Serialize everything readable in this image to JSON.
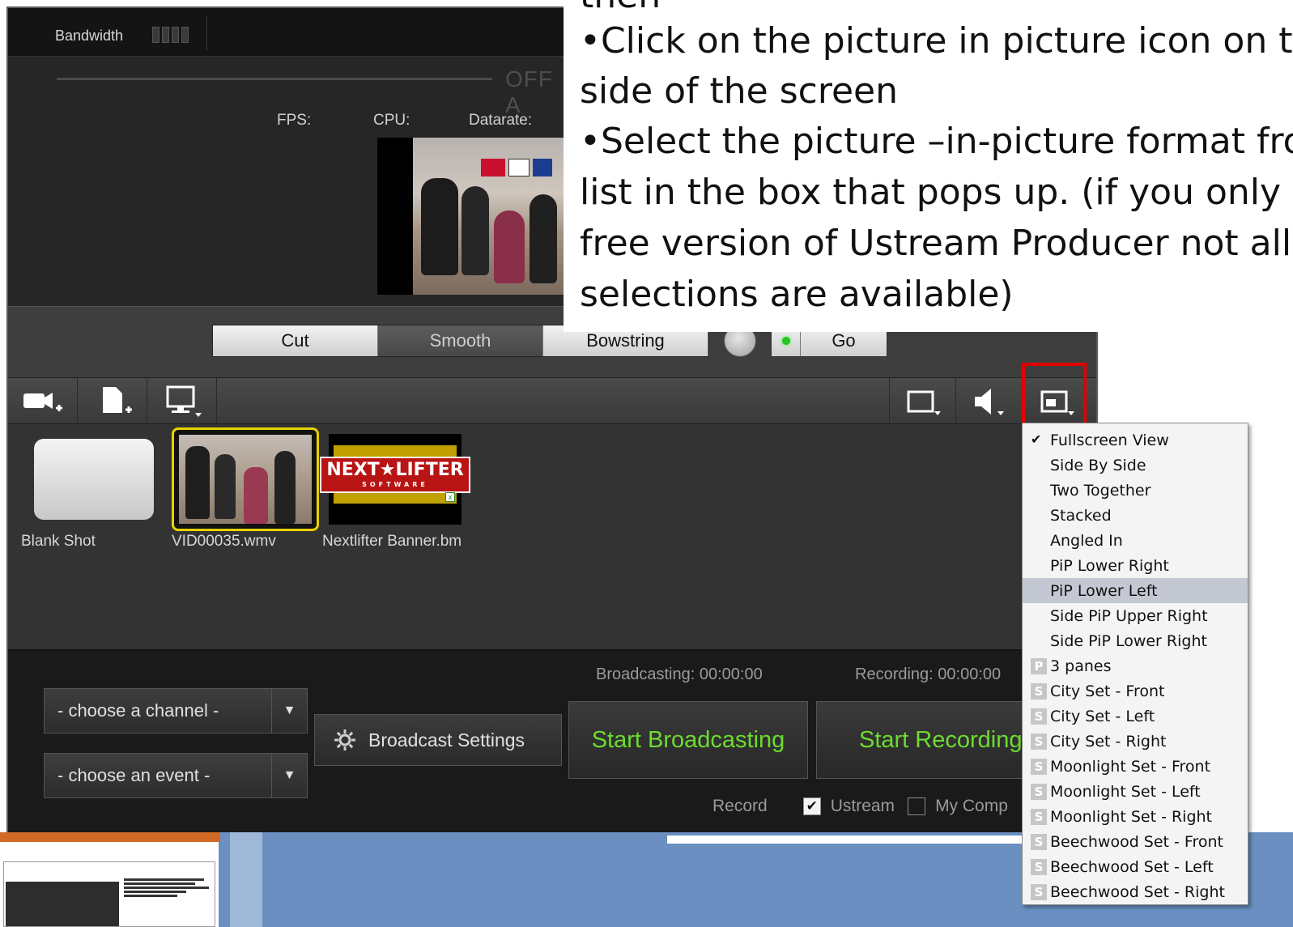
{
  "header": {
    "bandwidth_label": "Bandwidth",
    "off_label": "OFF A",
    "stats": {
      "fps": "FPS:",
      "cpu": "CPU:",
      "datarate": "Datarate:"
    }
  },
  "transitions": {
    "items": [
      "Cut",
      "Smooth",
      "Bowstring"
    ],
    "active": "Smooth",
    "go_label": "Go"
  },
  "toolbar": {
    "left": [
      "add-camera",
      "add-file",
      "add-screen"
    ],
    "right": [
      "layout",
      "audio",
      "picture-in-picture"
    ]
  },
  "media": {
    "items": [
      {
        "label": "Blank Shot"
      },
      {
        "label": "VID00035.wmv"
      },
      {
        "label": "Nextlifter Banner.bm"
      }
    ],
    "banner_logo": "NEXT★LIFTER",
    "banner_sub": "SOFTWARE"
  },
  "broadcast": {
    "broadcasting_time": "Broadcasting: 00:00:00",
    "recording_time": "Recording: 00:00:00",
    "channel_select": "- choose a channel -",
    "event_select": "- choose an event -",
    "settings_label": "Broadcast Settings",
    "start_broadcasting": "Start Broadcasting",
    "start_recording": "Start Recording",
    "record_label": "Record",
    "ustream_label": "Ustream",
    "mycomputer_label": "My Comp"
  },
  "pip_menu": {
    "items": [
      {
        "label": "Fullscreen View",
        "checked": true
      },
      {
        "label": "Side By Side"
      },
      {
        "label": "Two Together"
      },
      {
        "label": "Stacked"
      },
      {
        "label": "Angled In"
      },
      {
        "label": "PiP Lower Right"
      },
      {
        "label": "PiP Lower Left",
        "selected": true
      },
      {
        "label": "Side PiP Upper Right"
      },
      {
        "label": "Side PiP Lower Right"
      },
      {
        "label": "3 panes",
        "badge": "P"
      },
      {
        "label": "City Set - Front",
        "badge": "S"
      },
      {
        "label": "City Set - Left",
        "badge": "S"
      },
      {
        "label": "City Set - Right",
        "badge": "S"
      },
      {
        "label": "Moonlight Set - Front",
        "badge": "S"
      },
      {
        "label": "Moonlight Set - Left",
        "badge": "S"
      },
      {
        "label": "Moonlight Set - Right",
        "badge": "S"
      },
      {
        "label": "Beechwood Set - Front",
        "badge": "S"
      },
      {
        "label": "Beechwood Set - Left",
        "badge": "S"
      },
      {
        "label": "Beechwood Set - Right",
        "badge": "S"
      }
    ]
  },
  "instructions": {
    "lines": [
      "then",
      "•Click on the picture in picture icon on th",
      "side of the screen",
      "•Select the picture –in-picture format fro",
      "list in the box that pops up.  (if you only",
      "free version of Ustream Producer not all",
      "selections are available)"
    ]
  },
  "colors": {
    "accent_green": "#6ddc2e",
    "highlight_red": "#e00000",
    "selection_yellow": "#e8d100"
  }
}
